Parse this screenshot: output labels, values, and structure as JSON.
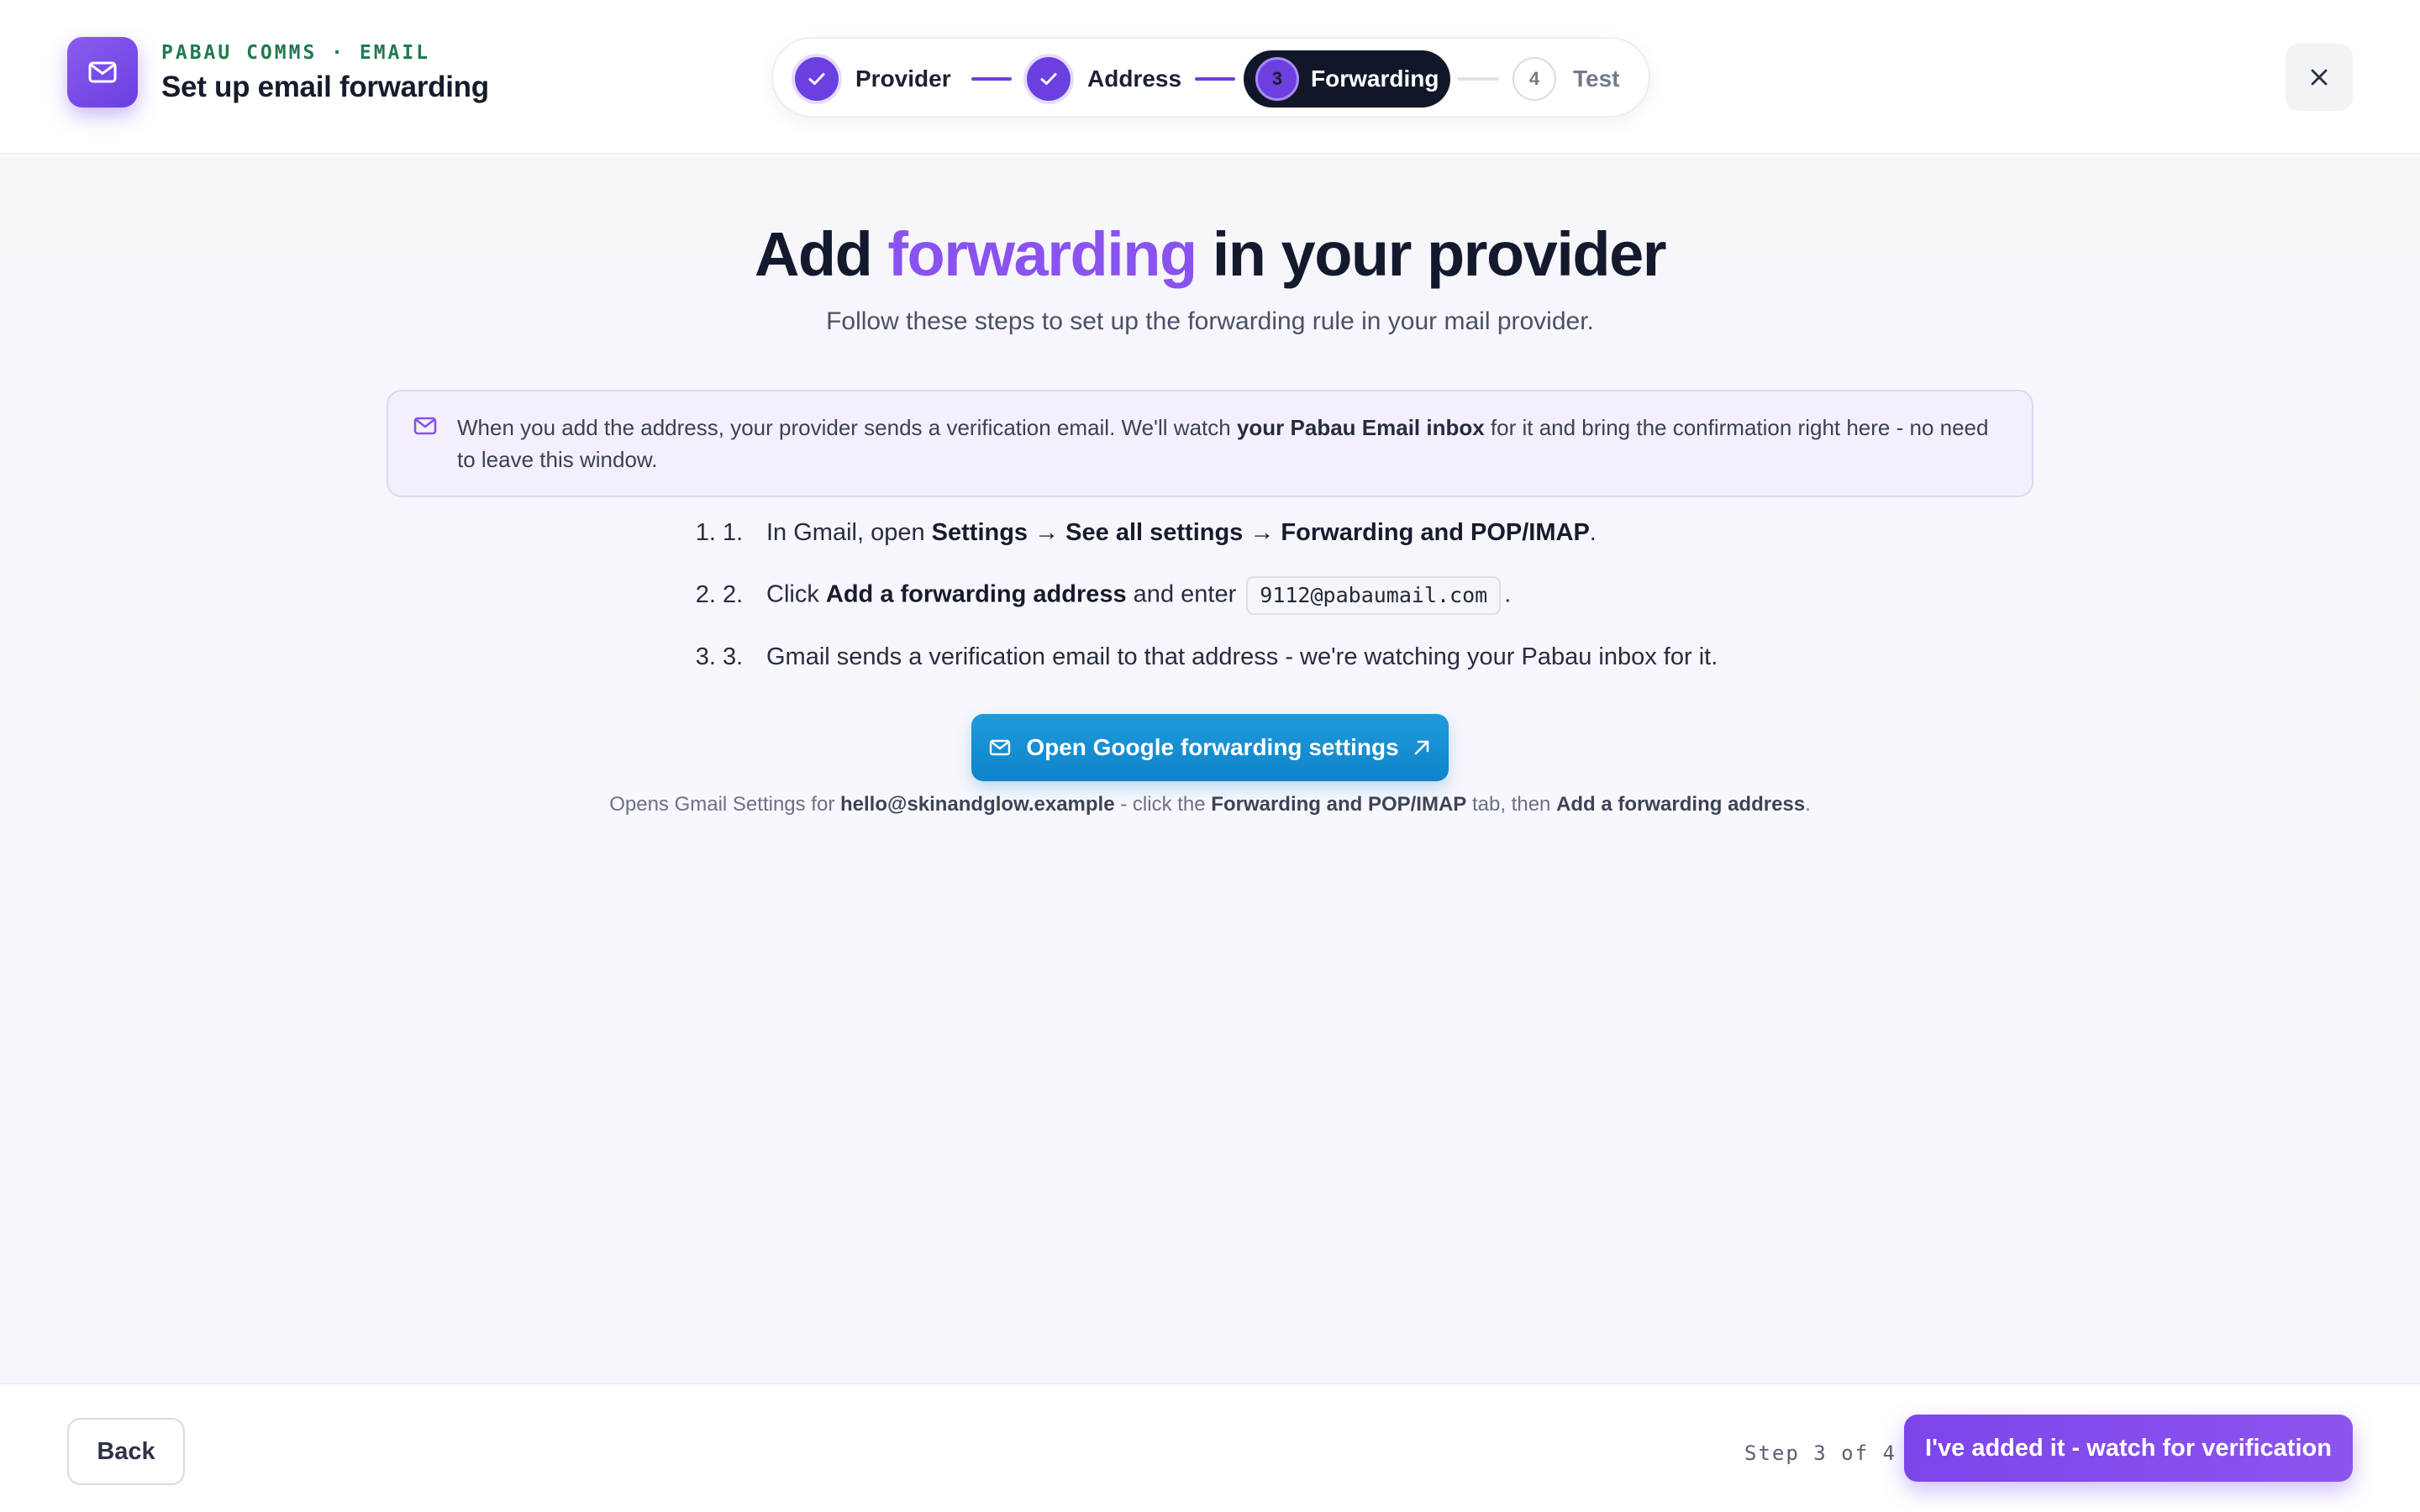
{
  "header": {
    "eyebrow": "PABAU COMMS · EMAIL",
    "title": "Set up email forwarding",
    "close_label": "Close"
  },
  "stepper": {
    "steps": [
      {
        "number": "1",
        "label": "Provider",
        "status": "complete"
      },
      {
        "number": "2",
        "label": "Address",
        "status": "complete"
      },
      {
        "number": "3",
        "label": "Forwarding",
        "status": "current"
      },
      {
        "number": "4",
        "label": "Test",
        "status": "upcoming"
      }
    ]
  },
  "main": {
    "headline": {
      "pre": "Add ",
      "accent": "forwarding",
      "post": " in your provider"
    },
    "subhead": "Follow these steps to set up the forwarding rule in your mail provider.",
    "notice": {
      "pre": "When you add the address, your provider sends a verification email. We'll watch ",
      "bold": "your Pabau Email inbox",
      "post": " for it and bring the confirmation right here - no need to leave this window."
    },
    "instructions": [
      {
        "number": "1.",
        "pre": "In Gmail, open ",
        "bold": "Settings → See all settings → Forwarding and POP/IMAP",
        "post": "."
      },
      {
        "number": "2.",
        "pre": "Click ",
        "bold": "Add a forwarding address",
        "mid": " and enter ",
        "code": "9112@pabaumail.com",
        "post": "."
      },
      {
        "number": "3.",
        "text": "Gmail sends a verification email to that address - we're watching your Pabau inbox for it."
      }
    ],
    "cta_label": "Open Google forwarding settings",
    "footnote": {
      "pre": "Opens Gmail Settings for ",
      "email": "hello@skinandglow.example",
      "mid": " - click the ",
      "tab": "Forwarding and POP/IMAP",
      "mid2": " tab, then ",
      "action": "Add a forwarding address",
      "post": "."
    }
  },
  "footer": {
    "back_label": "Back",
    "step_count": "Step 3 of 4",
    "primary_label": "I've added it - watch for verification"
  },
  "colors": {
    "brand_purple": "#6b3fe0",
    "accent_purple": "#8a52ef",
    "cta_blue": "#1292d5",
    "dark_pill": "#111729",
    "eyebrow_green": "#1f7a4f"
  }
}
